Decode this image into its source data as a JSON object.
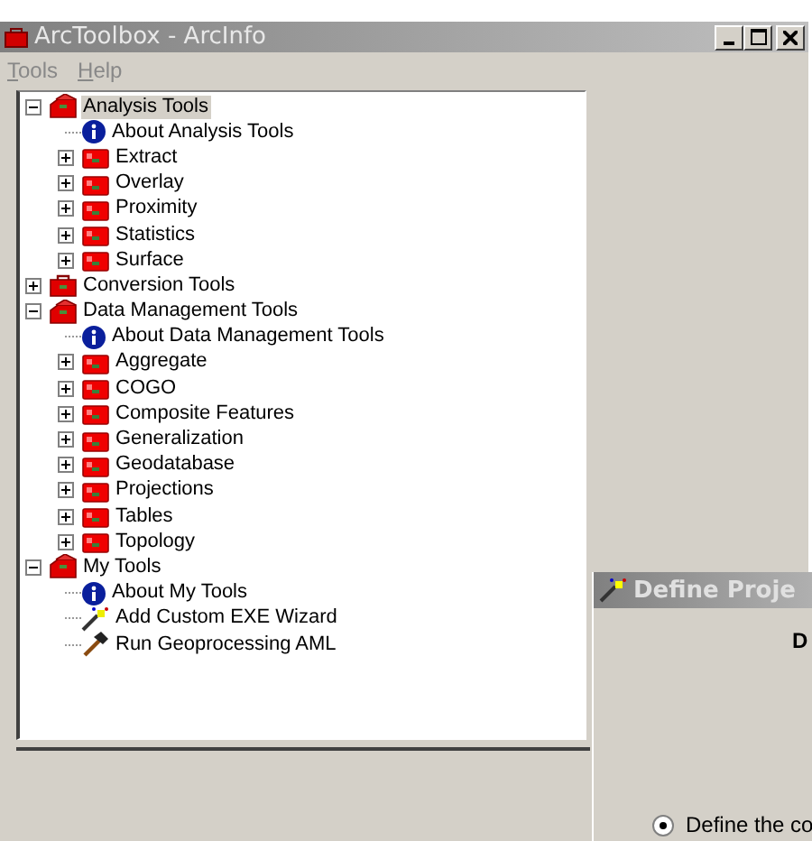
{
  "window": {
    "title": "ArcToolbox - ArcInfo",
    "active": false
  },
  "menu": [
    {
      "label": "Tools"
    },
    {
      "label": "Help"
    }
  ],
  "tree": [
    {
      "label": "Analysis Tools",
      "kind": "toolbox",
      "expanded": true,
      "selected": true,
      "children": [
        {
          "label": "About Analysis Tools",
          "kind": "info",
          "selected": false
        },
        {
          "label": "Extract",
          "kind": "toolset",
          "expanded": false,
          "selected": false
        },
        {
          "label": "Overlay",
          "kind": "toolset",
          "expanded": false,
          "selected": false
        },
        {
          "label": "Proximity",
          "kind": "toolset",
          "expanded": false,
          "selected": false
        },
        {
          "label": "Statistics",
          "kind": "toolset",
          "expanded": false,
          "selected": false
        },
        {
          "label": "Surface",
          "kind": "toolset",
          "expanded": false,
          "selected": false
        }
      ]
    },
    {
      "label": "Conversion Tools",
      "kind": "toolbox",
      "expanded": false,
      "selected": false
    },
    {
      "label": "Data Management Tools",
      "kind": "toolbox",
      "expanded": true,
      "selected": false,
      "children": [
        {
          "label": "About Data Management Tools",
          "kind": "info",
          "selected": false
        },
        {
          "label": "Aggregate",
          "kind": "toolset",
          "expanded": false,
          "selected": false
        },
        {
          "label": "COGO",
          "kind": "toolset",
          "expanded": false,
          "selected": false
        },
        {
          "label": "Composite Features",
          "kind": "toolset",
          "expanded": false,
          "selected": false
        },
        {
          "label": "Generalization",
          "kind": "toolset",
          "expanded": false,
          "selected": false
        },
        {
          "label": "Geodatabase",
          "kind": "toolset",
          "expanded": false,
          "selected": false
        },
        {
          "label": "Projections",
          "kind": "toolset",
          "expanded": false,
          "selected": false
        },
        {
          "label": "Tables",
          "kind": "toolset",
          "expanded": false,
          "selected": false
        },
        {
          "label": "Topology",
          "kind": "toolset",
          "expanded": false,
          "selected": false
        }
      ]
    },
    {
      "label": "My Tools",
      "kind": "toolbox",
      "expanded": true,
      "selected": false,
      "children": [
        {
          "label": "About My Tools",
          "kind": "info",
          "selected": false
        },
        {
          "label": "Add Custom EXE Wizard",
          "kind": "wizard",
          "selected": false
        },
        {
          "label": "Run Geoprocessing AML",
          "kind": "hammer",
          "selected": false
        }
      ]
    }
  ],
  "dialog": {
    "title": "Define Proje",
    "heading": "D",
    "options": [
      {
        "label": "Define the co",
        "selected": true
      }
    ]
  }
}
